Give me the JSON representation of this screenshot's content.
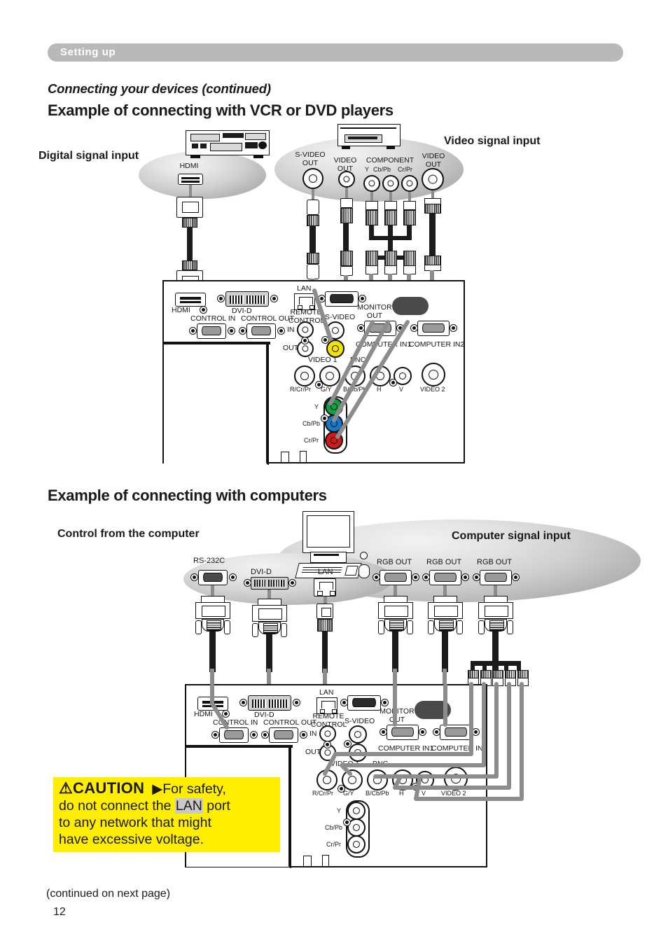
{
  "header": {
    "section_title": "Setting up"
  },
  "headings": {
    "subhead": "Connecting your devices (continued)",
    "section1": "Example of connecting with VCR or DVD players",
    "section2": "Example of connecting with computers"
  },
  "diagram1": {
    "callouts": {
      "digital": "Digital signal input",
      "video": "Video signal input"
    },
    "source_ports": [
      {
        "name": "hdmi",
        "label": "HDMI"
      },
      {
        "name": "s-video-out",
        "label_line1": "S-VIDEO",
        "label_line2": "OUT"
      },
      {
        "name": "video-out-1",
        "label_line1": "VIDEO",
        "label_line2": "OUT"
      },
      {
        "name": "component",
        "label": "COMPONENT",
        "sub": [
          "Y",
          "Cb/Pb",
          "Cr/Pr"
        ]
      },
      {
        "name": "video-out-2",
        "label_line1": "VIDEO",
        "label_line2": "OUT"
      }
    ],
    "panel_labels": {
      "hdmi": "HDMI",
      "dvi_d": "DVI-D",
      "control_in": "CONTROL IN",
      "control_out": "CONTROL OUT",
      "lan": "LAN",
      "remote_control_1": "REMOTE",
      "remote_control_2": "CONTROL",
      "in": "IN",
      "out": "OUT",
      "s_video": "S-VIDEO",
      "monitor_out_1": "MONITOR",
      "monitor_out_2": "OUT",
      "computer_in1": "COMPUTER IN1",
      "computer_in2": "COMPUTER IN2",
      "video1": "VIDEO 1",
      "bnc": "BNC",
      "bnc_r": "R/Cr/Pr",
      "bnc_g": "G/Y",
      "bnc_b": "B/Cb/Pb",
      "bnc_h": "H",
      "bnc_v": "V",
      "video2": "VIDEO 2",
      "comp_y": "Y",
      "comp_cb": "Cb/Pb",
      "comp_cr": "Cr/Pr"
    }
  },
  "diagram2": {
    "callouts": {
      "control": "Control from the computer",
      "computer": "Computer signal input"
    },
    "source_ports": [
      {
        "name": "rs-232c",
        "label": "RS-232C"
      },
      {
        "name": "dvi-d",
        "label": "DVI-D"
      },
      {
        "name": "lan",
        "label": "LAN"
      },
      {
        "name": "rgb-out-1",
        "label": "RGB OUT"
      },
      {
        "name": "rgb-out-2",
        "label": "RGB OUT"
      },
      {
        "name": "rgb-out-3",
        "label": "RGB OUT"
      }
    ],
    "panel_labels": {
      "hdmi": "HDMI",
      "dvi_d": "DVI-D",
      "control_in": "CONTROL IN",
      "control_out": "CONTROL OUT",
      "lan": "LAN",
      "remote_control_1": "REMOTE",
      "remote_control_2": "CONTROL",
      "in": "IN",
      "out": "OUT",
      "s_video": "S-VIDEO",
      "monitor_out_1": "MONITOR",
      "monitor_out_2": "OUT",
      "computer_in1": "COMPUTER IN1",
      "computer_in2": "COMPUTER IN2",
      "video1": "VIDEO 1",
      "bnc": "BNC",
      "bnc_r": "R/Cr/Pr",
      "bnc_g": "G/Y",
      "bnc_b": "B/Cb/Pb",
      "bnc_h": "H",
      "bnc_v": "V",
      "video2": "VIDEO 2",
      "comp_y": "Y",
      "comp_cb": "Cb/Pb",
      "comp_cr": "Cr/Pr"
    }
  },
  "caution": {
    "warning_glyph": "⚠",
    "title": "CAUTION",
    "arrow": "▶",
    "line1_rest": "For safety,",
    "line2_pre": "do not connect the ",
    "line2_hl": "LAN",
    "line2_post": " port",
    "line3": "to any network that might",
    "line4": "have excessive voltage."
  },
  "footer": {
    "continued": "(continued on next page)",
    "page_number": "12"
  },
  "colors": {
    "header_bar": "#b9b9b9",
    "caution_bg": "#ffee00",
    "video_jack_yellow": "#f2e400",
    "component_y_green": "#12a040",
    "component_cb_blue": "#1878c8",
    "component_cr_red": "#d01a1a",
    "cable_grey": "#8c8c8c"
  }
}
